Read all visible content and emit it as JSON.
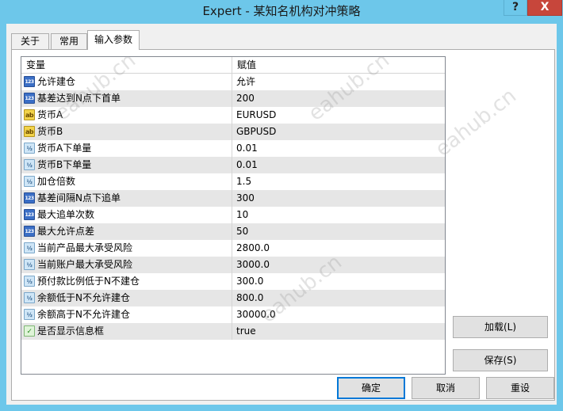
{
  "window": {
    "title": "Expert - 某知名机构对冲策略",
    "help_label": "?",
    "close_label": "X"
  },
  "tabs": [
    {
      "label": "关于",
      "active": false
    },
    {
      "label": "常用",
      "active": false
    },
    {
      "label": "输入参数",
      "active": true
    }
  ],
  "grid": {
    "columns": [
      "变量",
      "赋值"
    ],
    "rows": [
      {
        "icon": "123",
        "type": "int",
        "name": "允许建仓",
        "value": "允许"
      },
      {
        "icon": "123",
        "type": "int",
        "name": "基差达到N点下首单",
        "value": "200"
      },
      {
        "icon": "ab",
        "type": "string",
        "name": "货币A",
        "value": "EURUSD"
      },
      {
        "icon": "ab",
        "type": "string",
        "name": "货币B",
        "value": "GBPUSD"
      },
      {
        "icon": "½",
        "type": "double",
        "name": "货币A下单量",
        "value": "0.01"
      },
      {
        "icon": "½",
        "type": "double",
        "name": "货币B下单量",
        "value": "0.01"
      },
      {
        "icon": "½",
        "type": "double",
        "name": "加仓倍数",
        "value": "1.5"
      },
      {
        "icon": "123",
        "type": "int",
        "name": "基差间隔N点下追单",
        "value": "300"
      },
      {
        "icon": "123",
        "type": "int",
        "name": "最大追单次数",
        "value": "10"
      },
      {
        "icon": "123",
        "type": "int",
        "name": "最大允许点差",
        "value": "50"
      },
      {
        "icon": "½",
        "type": "double",
        "name": "当前产品最大承受风险",
        "value": "2800.0"
      },
      {
        "icon": "½",
        "type": "double",
        "name": "当前账户最大承受风险",
        "value": "3000.0"
      },
      {
        "icon": "½",
        "type": "double",
        "name": "预付款比例低于N不建仓",
        "value": "300.0"
      },
      {
        "icon": "½",
        "type": "double",
        "name": "余额低于N不允许建仓",
        "value": "800.0"
      },
      {
        "icon": "½",
        "type": "double",
        "name": "余额高于N不允许建仓",
        "value": "30000.0"
      },
      {
        "icon": "✓",
        "type": "bool",
        "name": "是否显示信息框",
        "value": "true"
      }
    ]
  },
  "side_buttons": {
    "load_label": "加载(L)",
    "save_label": "保存(S)"
  },
  "footer_buttons": {
    "ok_label": "确定",
    "cancel_label": "取消",
    "reset_label": "重设"
  },
  "watermark": "eahub.cn",
  "colors": {
    "titlebar": "#6dc7ea",
    "close": "#c7463b",
    "alt_row": "#e6e6e6"
  }
}
